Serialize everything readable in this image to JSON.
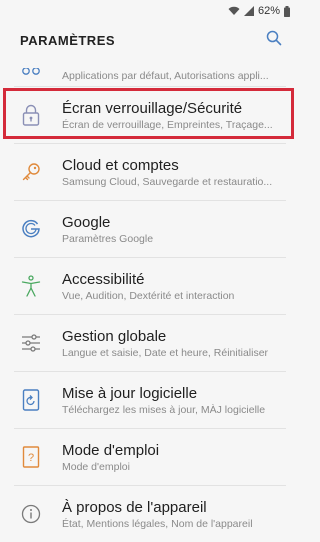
{
  "status": {
    "battery": "62%"
  },
  "header": {
    "title": "PARAMÈTRES",
    "search_icon": "search-icon"
  },
  "items": [
    {
      "label": "",
      "sub": "Applications par défaut, Autorisations appli...",
      "icon": "apps-icon"
    },
    {
      "label": "Écran verrouillage/Sécurité",
      "sub": "Écran de verrouillage, Empreintes, Traçage...",
      "icon": "lock-icon"
    },
    {
      "label": "Cloud et comptes",
      "sub": "Samsung Cloud, Sauvegarde et restauratio...",
      "icon": "key-icon"
    },
    {
      "label": "Google",
      "sub": "Paramètres Google",
      "icon": "google-icon"
    },
    {
      "label": "Accessibilité",
      "sub": "Vue, Audition, Dextérité et interaction",
      "icon": "accessibility-icon"
    },
    {
      "label": "Gestion globale",
      "sub": "Langue et saisie, Date et heure, Réinitialiser",
      "icon": "sliders-icon"
    },
    {
      "label": "Mise à jour logicielle",
      "sub": "Téléchargez les mises à jour, MÀJ logicielle",
      "icon": "software-update-icon"
    },
    {
      "label": "Mode d'emploi",
      "sub": "Mode d'emploi",
      "icon": "user-manual-icon"
    },
    {
      "label": "À propos de l'appareil",
      "sub": "État, Mentions légales, Nom de l'appareil",
      "icon": "info-icon"
    }
  ],
  "colors": {
    "highlight": "#d42a3a",
    "icon_blue": "#4a7fc1",
    "icon_orange": "#e08a3c",
    "icon_green": "#4aa860"
  }
}
